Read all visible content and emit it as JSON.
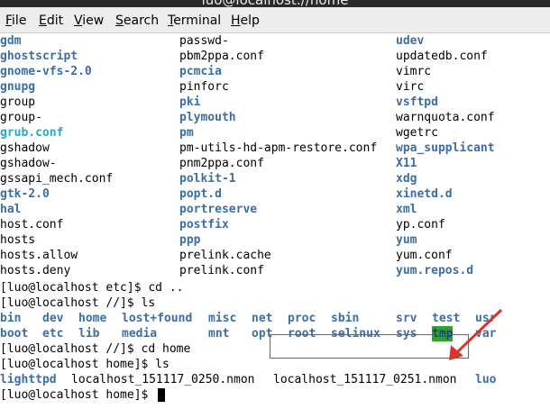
{
  "window": {
    "title": "luo@localhost://home"
  },
  "menu": [
    "File",
    "Edit",
    "View",
    "Search",
    "Terminal",
    "Help"
  ],
  "listing": {
    "col1": [
      {
        "t": "gdm",
        "c": "dir"
      },
      {
        "t": "ghostscript",
        "c": "dir"
      },
      {
        "t": "gnome-vfs-2.0",
        "c": "dir"
      },
      {
        "t": "gnupg",
        "c": "dir"
      },
      {
        "t": "group",
        "c": ""
      },
      {
        "t": "group-",
        "c": ""
      },
      {
        "t": "grub.conf",
        "c": "link"
      },
      {
        "t": "gshadow",
        "c": ""
      },
      {
        "t": "gshadow-",
        "c": ""
      },
      {
        "t": "gssapi_mech.conf",
        "c": ""
      },
      {
        "t": "gtk-2.0",
        "c": "dir"
      },
      {
        "t": "hal",
        "c": "dir"
      },
      {
        "t": "host.conf",
        "c": ""
      },
      {
        "t": "hosts",
        "c": ""
      },
      {
        "t": "hosts.allow",
        "c": ""
      },
      {
        "t": "hosts.deny",
        "c": ""
      }
    ],
    "col2": [
      {
        "t": "passwd-",
        "c": ""
      },
      {
        "t": "pbm2ppa.conf",
        "c": ""
      },
      {
        "t": "pcmcia",
        "c": "dir"
      },
      {
        "t": "pinforc",
        "c": ""
      },
      {
        "t": "pki",
        "c": "dir"
      },
      {
        "t": "plymouth",
        "c": "dir"
      },
      {
        "t": "pm",
        "c": "dir"
      },
      {
        "t": "pm-utils-hd-apm-restore.conf",
        "c": ""
      },
      {
        "t": "pnm2ppa.conf",
        "c": ""
      },
      {
        "t": "polkit-1",
        "c": "dir"
      },
      {
        "t": "popt.d",
        "c": "dir"
      },
      {
        "t": "portreserve",
        "c": "dir"
      },
      {
        "t": "postfix",
        "c": "dir"
      },
      {
        "t": "ppp",
        "c": "dir"
      },
      {
        "t": "prelink.cache",
        "c": ""
      },
      {
        "t": "prelink.conf",
        "c": ""
      }
    ],
    "col3": [
      {
        "t": "udev",
        "c": "dir"
      },
      {
        "t": "updatedb.conf",
        "c": ""
      },
      {
        "t": "vimrc",
        "c": ""
      },
      {
        "t": "virc",
        "c": ""
      },
      {
        "t": "vsftpd",
        "c": "dir"
      },
      {
        "t": "warnquota.conf",
        "c": ""
      },
      {
        "t": "wgetrc",
        "c": ""
      },
      {
        "t": "wpa_supplicant",
        "c": "dir"
      },
      {
        "t": "X11",
        "c": "dir"
      },
      {
        "t": "xdg",
        "c": "dir"
      },
      {
        "t": "xinetd.d",
        "c": "dir"
      },
      {
        "t": "xml",
        "c": "dir"
      },
      {
        "t": "yp.conf",
        "c": ""
      },
      {
        "t": "yum",
        "c": "dir"
      },
      {
        "t": "yum.conf",
        "c": ""
      },
      {
        "t": "yum.repos.d",
        "c": "dir"
      }
    ]
  },
  "commands": {
    "cd_up": "[luo@localhost etc]$ cd ..",
    "ls_root": "[luo@localhost //]$ ls",
    "cd_home": "[luo@localhost //]$ cd home",
    "ls_home": "[luo@localhost home]$ ls",
    "prompt": "[luo@localhost home]$ "
  },
  "root_listing": {
    "row1": [
      {
        "t": "bin",
        "c": "dir"
      },
      {
        "t": "dev",
        "c": "dir"
      },
      {
        "t": "home",
        "c": "dir"
      },
      {
        "t": "lost+found",
        "c": "dir"
      },
      {
        "t": "misc",
        "c": "dir"
      },
      {
        "t": "net",
        "c": "dir"
      },
      {
        "t": "proc",
        "c": "dir"
      },
      {
        "t": "sbin",
        "c": "dir"
      },
      {
        "t": "srv",
        "c": "dir"
      },
      {
        "t": "test",
        "c": "dir"
      },
      {
        "t": "usr",
        "c": "dir"
      }
    ],
    "row2": [
      {
        "t": "boot",
        "c": "dir"
      },
      {
        "t": "etc",
        "c": "dir"
      },
      {
        "t": "lib",
        "c": "dir"
      },
      {
        "t": "media",
        "c": "dir"
      },
      {
        "t": "mnt",
        "c": "dir"
      },
      {
        "t": "opt",
        "c": "dir"
      },
      {
        "t": "root",
        "c": "dir"
      },
      {
        "t": "selinux",
        "c": "dir"
      },
      {
        "t": "sys",
        "c": "dir"
      },
      {
        "t": "tmp",
        "c": "hl"
      },
      {
        "t": "var",
        "c": "dir"
      }
    ]
  },
  "home_listing": [
    {
      "t": "lighttpd",
      "c": "dir"
    },
    {
      "t": "localhost_151117_0250.nmon",
      "c": ""
    },
    {
      "t": "localhost_151117_0251.nmon",
      "c": ""
    },
    {
      "t": "luo",
      "c": "dir"
    }
  ],
  "annotation_color": "#d9342b"
}
